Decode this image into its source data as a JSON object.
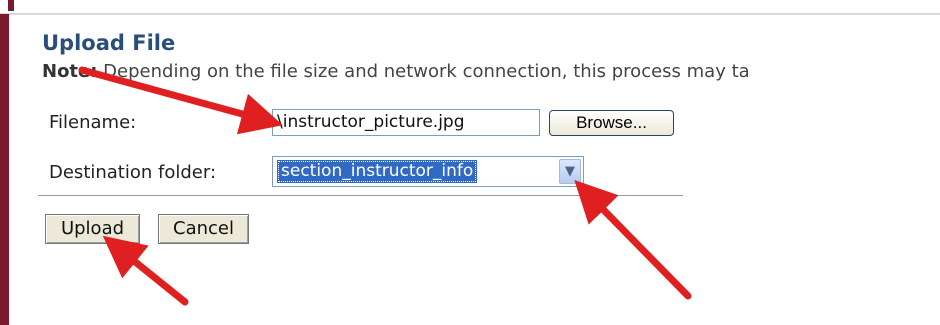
{
  "form": {
    "title": "Upload File",
    "note_label": "Note:",
    "note_text": " Depending on the file size and network connection, this process may ta",
    "filename_label": "Filename:",
    "filename_value": "\\instructor_picture.jpg",
    "browse_label": "Browse...",
    "destination_label": "Destination folder:",
    "destination_value": "section_instructor_info",
    "upload_label": "Upload",
    "cancel_label": "Cancel"
  },
  "colors": {
    "accent_bar": "#7b1a2c",
    "title": "#2a4e7b",
    "selection": "#316ac5",
    "annotation_arrow": "#e02020"
  },
  "icons": {
    "dropdown": "chevron-down-icon",
    "annotation": "arrow-icon"
  }
}
